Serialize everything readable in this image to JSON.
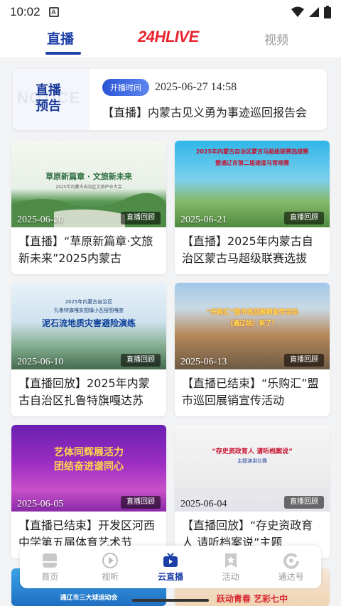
{
  "status_bar": {
    "time": "10:02",
    "notification_letter": "A"
  },
  "top_nav": {
    "live_tab": "直播",
    "logo": "24HLIVE",
    "video_tab": "视频"
  },
  "notice": {
    "watermark": "NOTICE",
    "title": "直播预告",
    "badge": "开播时间",
    "datetime": "2025-06-27  14:58",
    "text": "【直播】内蒙古见义勇为事迹巡回报告会"
  },
  "cards": [
    {
      "date": "2025-06-20",
      "tag": "直播回顾",
      "title": "【直播】“草原新篇章·文旅新未来”2025内蒙古",
      "thumb_lines": [
        "草原新篇章 · 文旅新未来",
        "2025年内蒙古自治区文旅产业大会"
      ]
    },
    {
      "date": "2025-06-21",
      "tag": "直播回顾",
      "title": "【直播】2025年内蒙古自治区蒙古马超级联赛选拔",
      "thumb_lines": [
        "2025年内蒙古自治区蒙古马超级联赛选拔赛",
        "暨通辽市第二届速度马常规赛"
      ]
    },
    {
      "date": "2025-06-10",
      "tag": "直播回顾",
      "title": "【直播回放】2025年内蒙古自治区扎鲁特旗嘎达苏",
      "thumb_lines": [
        "2025年内蒙古自治区",
        "扎鲁特旗嘎亥图镇小瓦窑图嘎查",
        "泥石流地质灾害避险演练"
      ]
    },
    {
      "date": "2025-06-13",
      "tag": "直播回顾",
      "title": "【直播已结束】“乐购汇”盟市巡回展销宣传活动",
      "thumb_lines": [
        "“乐购汇”盟市巡回展销宣传活动",
        "（通辽站）来了！"
      ]
    },
    {
      "date": "2025-06-05",
      "tag": "直播回顾",
      "title": "【直播已结束】开发区河西中学第五届体育艺术节",
      "thumb_lines": [
        "艺体同辉展活力",
        "团结奋进谱同心"
      ]
    },
    {
      "date": "2025-06-04",
      "tag": "直播回顾",
      "title": "【直播回放】“存史资政育人 请听档案说”主题",
      "thumb_lines": [
        "“存史资政育人  请听档案说”",
        "主题演讲比赛"
      ]
    }
  ],
  "peek_cards": [
    {
      "thumb_line": "通辽市三大球运动会"
    },
    {
      "thumb_line": "跃动青春 艺彩七中"
    }
  ],
  "bottom_nav": [
    {
      "label": "首页",
      "icon": "home-icon"
    },
    {
      "label": "视听",
      "icon": "play-icon"
    },
    {
      "label": "云直播",
      "icon": "tv-icon"
    },
    {
      "label": "活动",
      "icon": "star-bookmark-icon"
    },
    {
      "label": "通达号",
      "icon": "refresh-c-icon"
    }
  ],
  "colors": {
    "accent": "#1d3fa8",
    "logo_red": "#e8242e"
  }
}
